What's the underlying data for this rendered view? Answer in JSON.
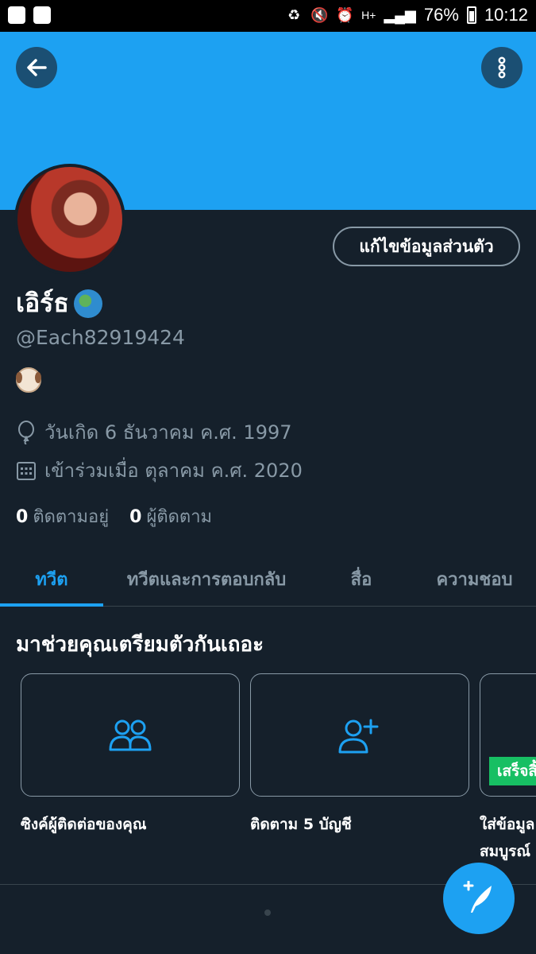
{
  "status_bar": {
    "battery": "76%",
    "time": "10:12",
    "network": "H+"
  },
  "header": {
    "back_icon": "arrow-left-icon",
    "more_icon": "more-vertical-icon"
  },
  "profile": {
    "edit_button": "แก้ไขข้อมูลส่วนตัว",
    "display_name": "เอิร์ธ",
    "name_emoji": "globe-emoji",
    "handle": "@Each82919424",
    "bio_emoji": "dog-face-emoji",
    "birthday": "วันเกิด 6 ธันวาคม ค.ศ. 1997",
    "joined": "เข้าร่วมเมื่อ ตุลาคม ค.ศ. 2020",
    "following_count": "0",
    "following_label": "ติดตามอยู่",
    "followers_count": "0",
    "followers_label": "ผู้ติดตาม"
  },
  "tabs": [
    {
      "label": "ทวีต",
      "active": true
    },
    {
      "label": "ทวีตและการตอบกลับ",
      "active": false
    },
    {
      "label": "สื่อ",
      "active": false
    },
    {
      "label": "ความชอบ",
      "active": false
    }
  ],
  "onboarding": {
    "title": "มาช่วยคุณเตรียมตัวกันเถอะ",
    "cards": [
      {
        "icon": "people-icon",
        "label": "ซิงค์ผู้ติดต่อของคุณ"
      },
      {
        "icon": "add-user-icon",
        "label": "ติดตาม 5 บัญชี"
      },
      {
        "icon": "",
        "label": "ใส่ข้อมูล",
        "label2": "สมบูรณ์"
      }
    ],
    "done_badge": "เสร็จสิ้น"
  },
  "fab": {
    "icon": "compose-tweet-icon"
  },
  "colors": {
    "accent": "#1da1f2",
    "background": "#15202b",
    "muted": "#8899a6",
    "success": "#17bf63"
  }
}
